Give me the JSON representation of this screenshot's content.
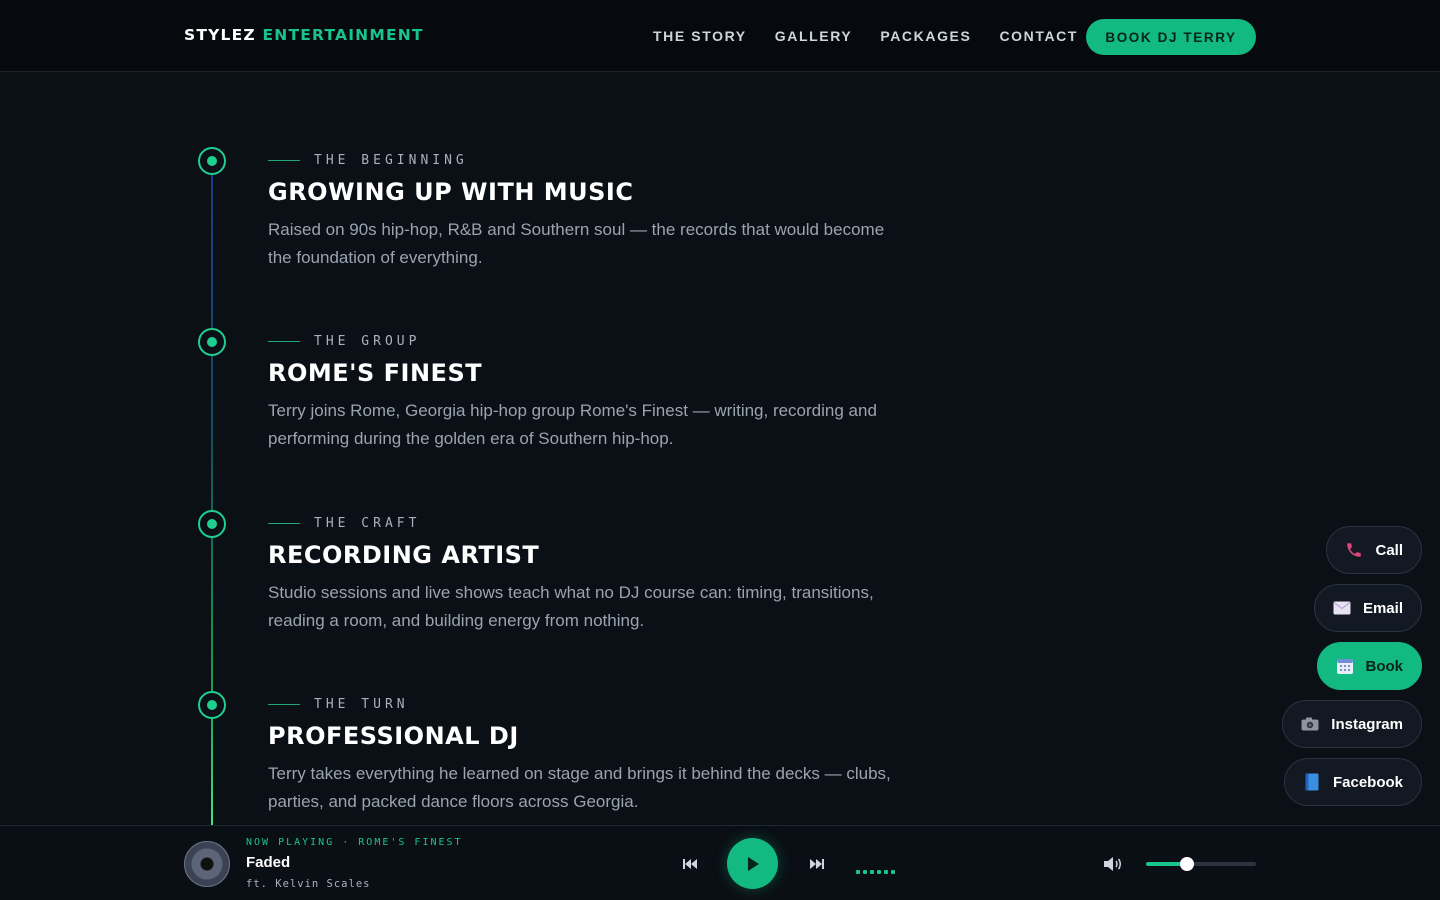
{
  "brand": {
    "name": "STYLEZ",
    "accent": "ENTERTAINMENT"
  },
  "nav": {
    "links": [
      "THE STORY",
      "GALLERY",
      "PACKAGES",
      "CONTACT"
    ],
    "cta": "BOOK DJ TERRY"
  },
  "timeline": [
    {
      "eyebrow": "THE BEGINNING",
      "title": "GROWING UP WITH MUSIC",
      "text": "Raised on 90s hip-hop, R&B and Southern soul — the records that would become the foundation of everything."
    },
    {
      "eyebrow": "THE GROUP",
      "title": "ROME'S FINEST",
      "text": "Terry joins Rome, Georgia hip-hop group Rome's Finest — writing, recording and performing during the golden era of Southern hip-hop."
    },
    {
      "eyebrow": "THE CRAFT",
      "title": "RECORDING ARTIST",
      "text": "Studio sessions and live shows teach what no DJ course can: timing, transitions, reading a room, and building energy from nothing."
    },
    {
      "eyebrow": "THE TURN",
      "title": "PROFESSIONAL DJ",
      "text": "Terry takes everything he learned on stage and brings it behind the decks — clubs, parties, and packed dance floors across Georgia."
    }
  ],
  "side_buttons": [
    {
      "label": "Call",
      "icon": "phone-icon"
    },
    {
      "label": "Email",
      "icon": "envelope-icon"
    },
    {
      "label": "Book",
      "icon": "calendar-icon"
    },
    {
      "label": "Instagram",
      "icon": "camera-icon"
    },
    {
      "label": "Facebook",
      "icon": "book-icon"
    }
  ],
  "player": {
    "now_playing": "NOW PLAYING · ROME'S FINEST",
    "title": "Faded",
    "artist": "ft. Kelvin Scales",
    "volume": 0.37
  },
  "colors": {
    "accent": "#12b981",
    "background": "#0b0f16"
  }
}
